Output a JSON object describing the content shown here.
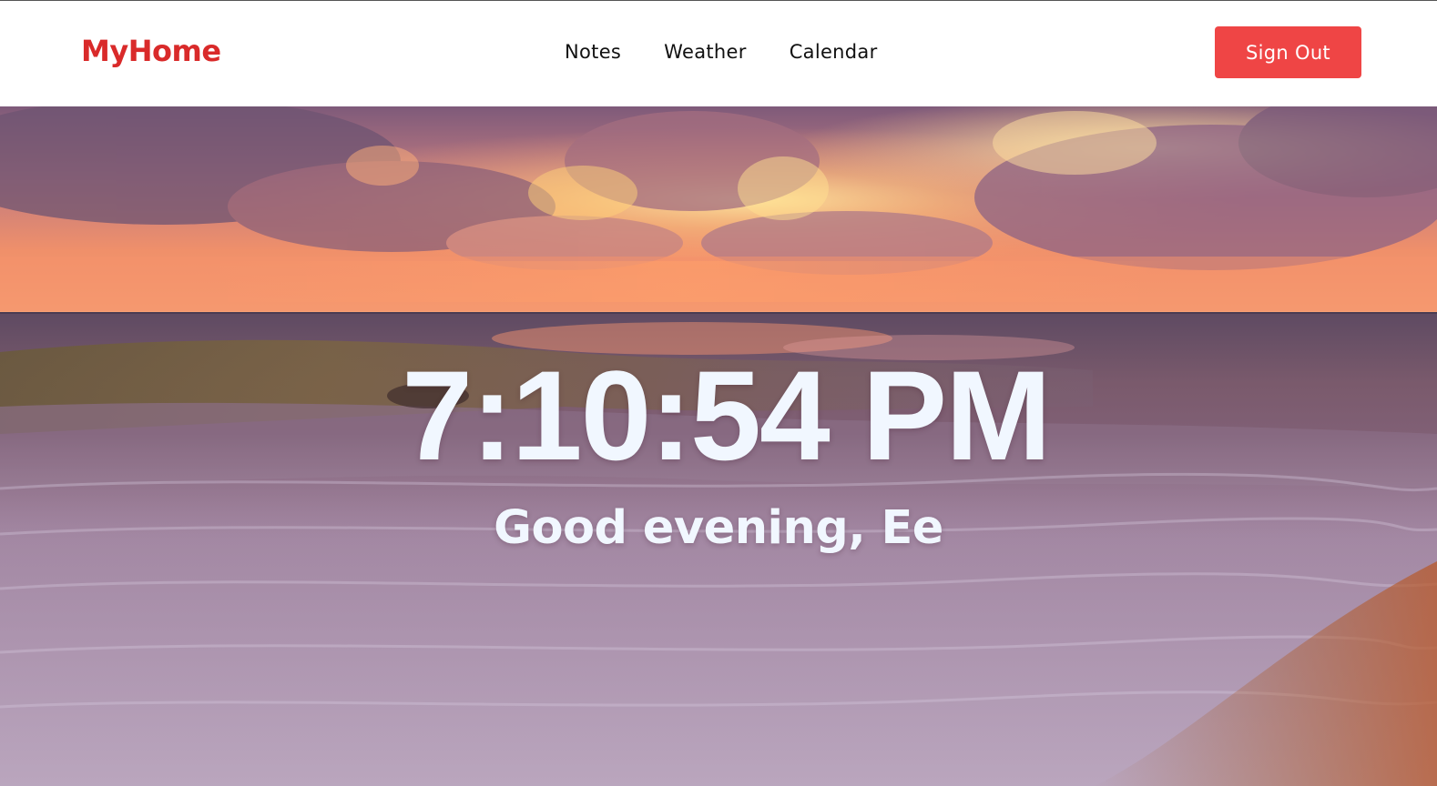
{
  "navbar": {
    "brand": "MyHome",
    "links": [
      {
        "label": "Notes"
      },
      {
        "label": "Weather"
      },
      {
        "label": "Calendar"
      }
    ],
    "sign_out_label": "Sign Out"
  },
  "hero": {
    "time": "7:10:54 PM",
    "greeting": "Good evening, Ee"
  },
  "colors": {
    "brand": "#d92a2a",
    "button": "#ef4545",
    "clock_text": "#f1f7ff",
    "nav_text": "#111111"
  }
}
